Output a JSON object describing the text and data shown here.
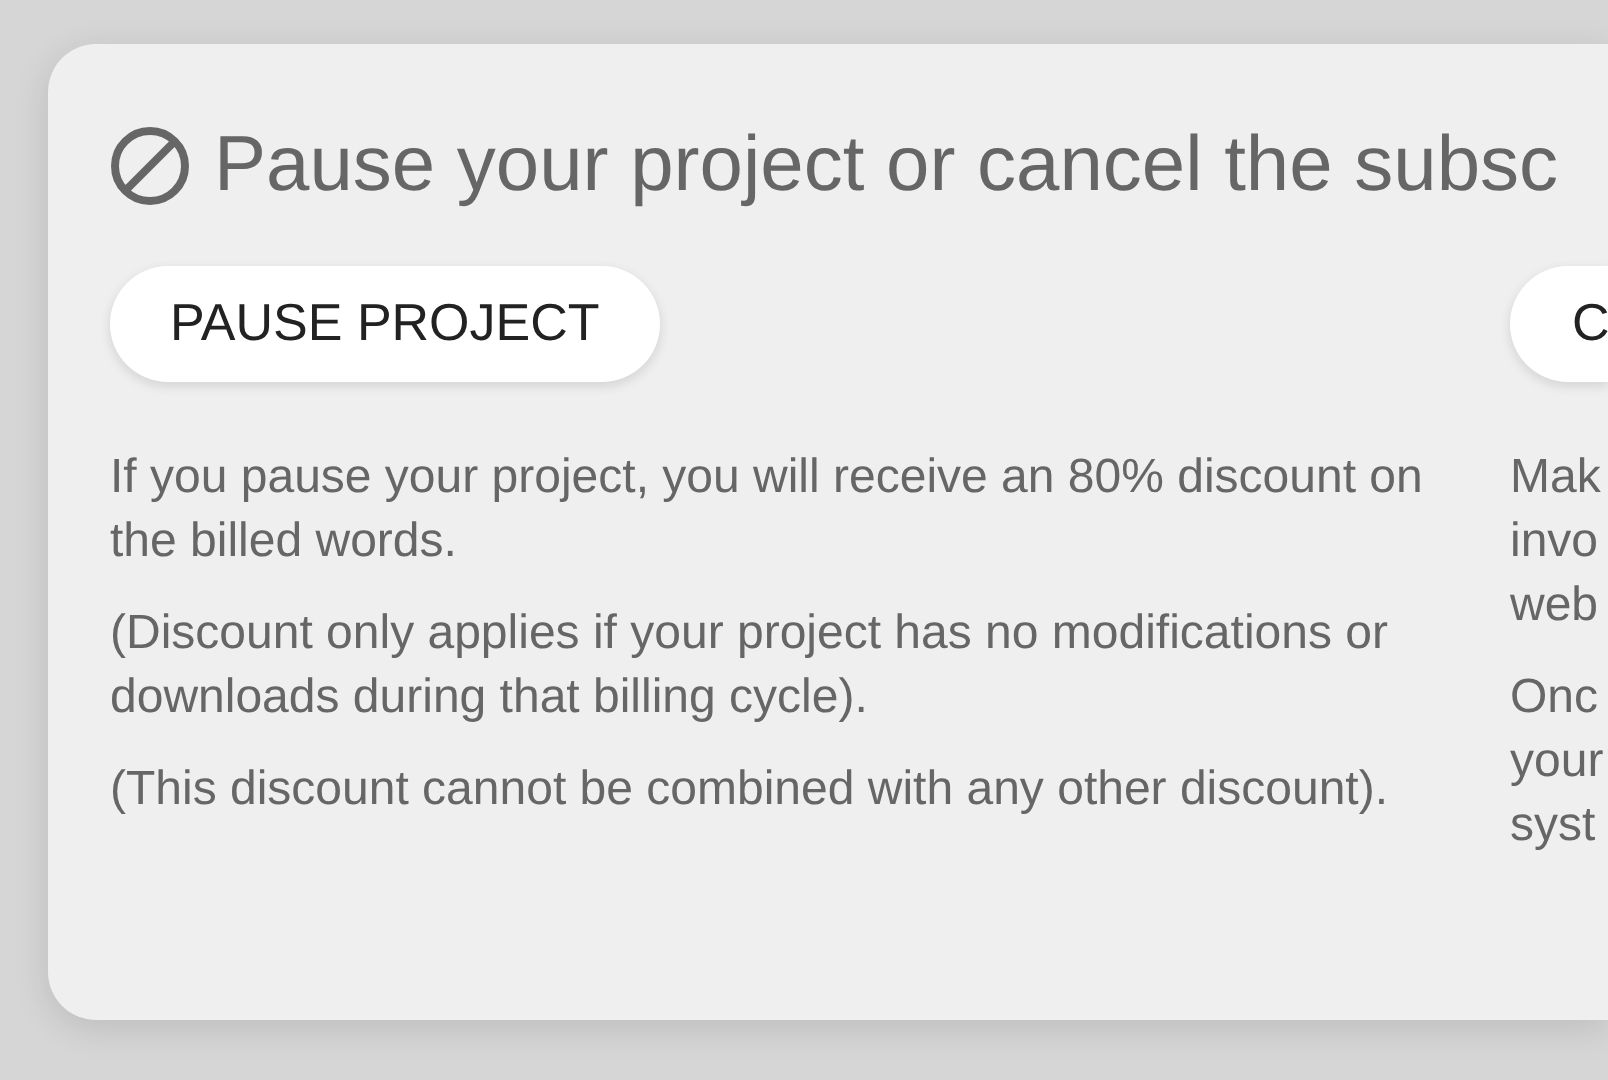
{
  "title": {
    "text": "Pause your project or cancel the subsc"
  },
  "options": [
    {
      "button": "PAUSE PROJECT",
      "paragraphs": [
        {
          "text": "If you pause your project, you will receive an 80% discount on the billed words."
        },
        {
          "text": "(Discount only applies if your project has no modifications or downloads during that billing cycle)."
        },
        {
          "text": "(This discount cannot be combined with any other discount)."
        }
      ]
    },
    {
      "button": "C",
      "paragraphs": [
        {
          "lines": [
            "Mak",
            "invo",
            "web"
          ]
        },
        {
          "lines": [
            "Onc",
            "your",
            "syst"
          ]
        }
      ]
    }
  ]
}
